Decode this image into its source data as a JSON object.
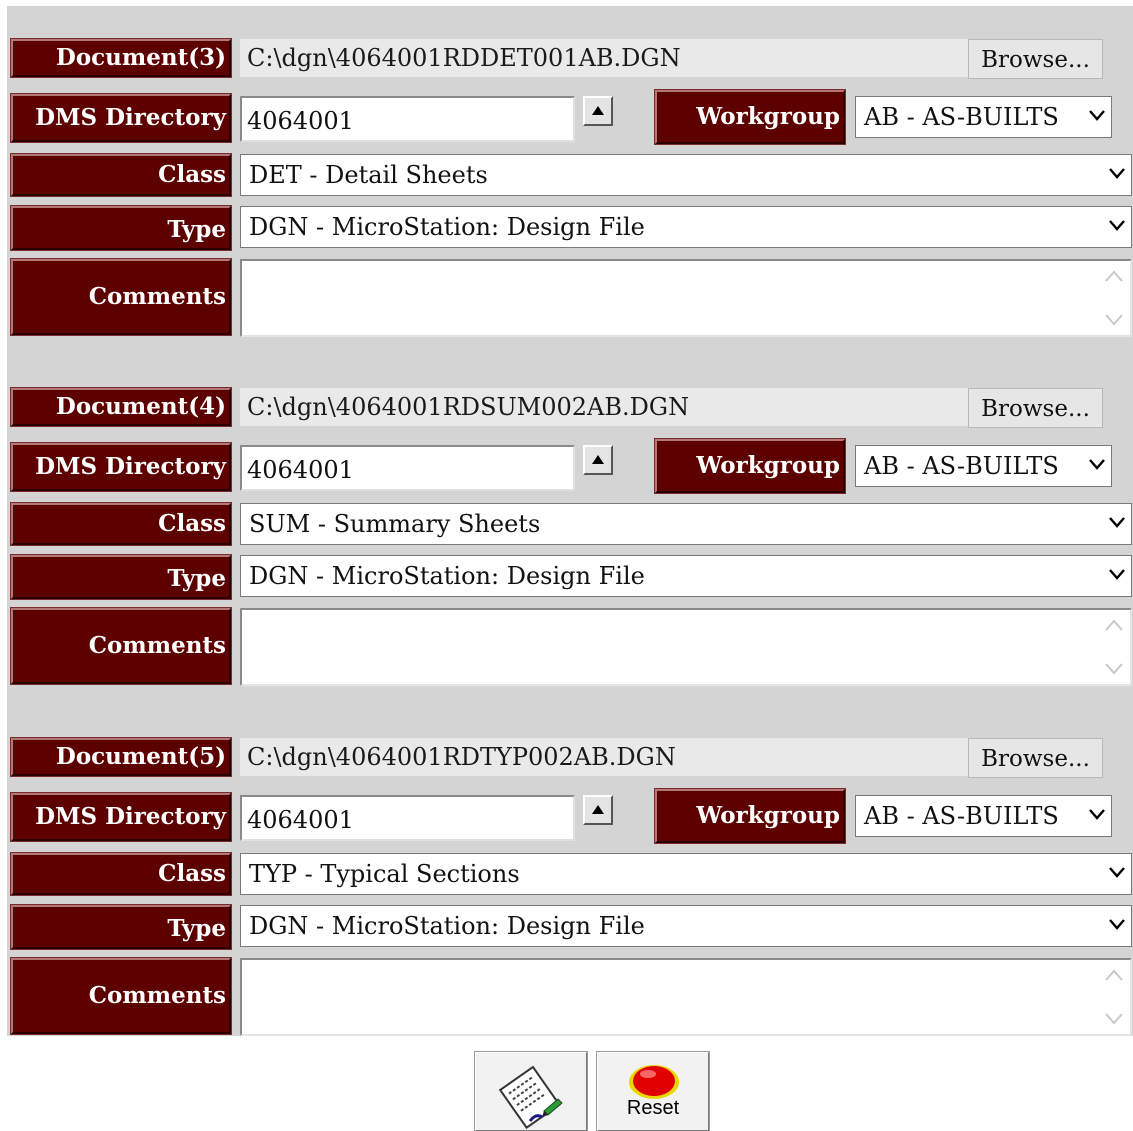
{
  "labels": {
    "dms_directory": "DMS Directory",
    "workgroup": "Workgroup",
    "class": "Class",
    "type": "Type",
    "comments": "Comments",
    "browse": "Browse..."
  },
  "documents": [
    {
      "label": "Document(3)",
      "path": "C:\\dgn\\4064001RDDET001AB.DGN",
      "dms_directory": "4064001",
      "workgroup": "AB - AS-BUILTS",
      "class": "DET - Detail Sheets",
      "type": "DGN - MicroStation: Design File",
      "comments": ""
    },
    {
      "label": "Document(4)",
      "path": "C:\\dgn\\4064001RDSUM002AB.DGN",
      "dms_directory": "4064001",
      "workgroup": "AB - AS-BUILTS",
      "class": "SUM - Summary Sheets",
      "type": "DGN - MicroStation: Design File",
      "comments": ""
    },
    {
      "label": "Document(5)",
      "path": "C:\\dgn\\4064001RDTYP002AB.DGN",
      "dms_directory": "4064001",
      "workgroup": "AB - AS-BUILTS",
      "class": "TYP - Typical Sections",
      "type": "DGN - MicroStation: Design File",
      "comments": ""
    }
  ],
  "buttons": {
    "reset_label": "Reset"
  },
  "icons": {
    "submit": "document-pen-icon",
    "reset": "red-button-icon",
    "spinner": "up-arrow-icon",
    "dropdown": "chevron-down-icon"
  },
  "colors": {
    "label_bg": "#5c0000",
    "label_text": "#ffffff",
    "panel_bg": "#d4d4d4"
  }
}
